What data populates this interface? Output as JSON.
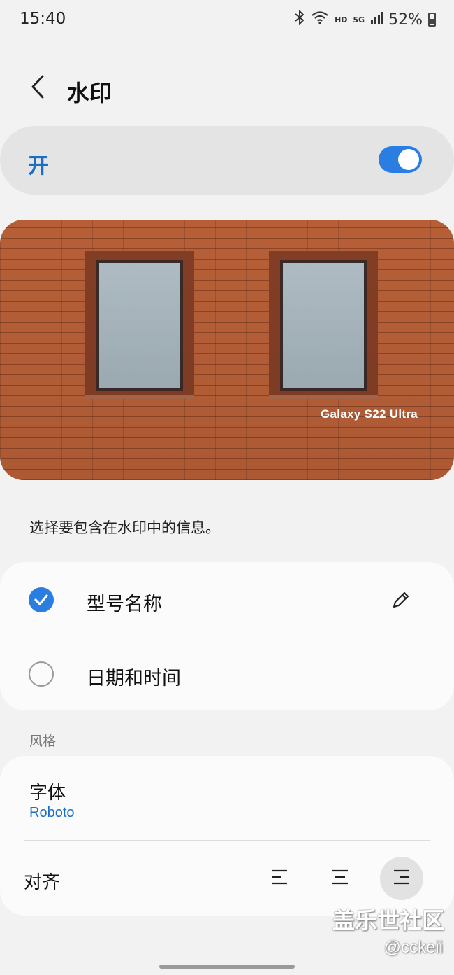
{
  "status_bar": {
    "time": "15:40",
    "hd": "HD",
    "network": "5G",
    "battery": "52%",
    "icons": [
      "bluetooth-icon",
      "wifi-icon",
      "signal-icon",
      "battery-icon"
    ]
  },
  "header": {
    "title": "水印",
    "back_icon": "back-arrow-icon"
  },
  "master_toggle": {
    "label": "开",
    "state": "on"
  },
  "preview": {
    "watermark_text": "Galaxy S22 Ultra"
  },
  "description": "选择要包含在水印中的信息。",
  "options": [
    {
      "label": "型号名称",
      "checked": true,
      "edit_icon": "pencil-icon"
    },
    {
      "label": "日期和时间",
      "checked": false
    }
  ],
  "style_section": {
    "label": "风格",
    "font": {
      "title": "字体",
      "value": "Roboto"
    },
    "alignment": {
      "title": "对齐",
      "options": [
        "align-left-icon",
        "align-center-icon",
        "align-right-icon"
      ],
      "selected": "align-right-icon"
    }
  },
  "overlay": {
    "community": "盖乐世社区",
    "handle": "@cckeii"
  },
  "colors": {
    "accent": "#2a7de1",
    "link": "#1a6fc4",
    "background": "#f2f2f2"
  }
}
